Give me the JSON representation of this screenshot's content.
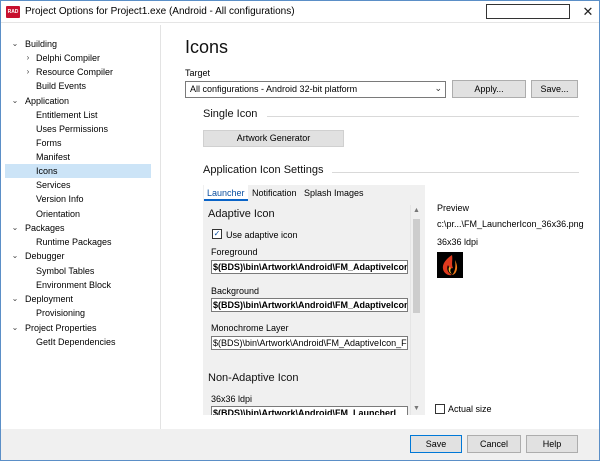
{
  "window": {
    "title": "Project Options for Project1.exe  (Android - All configurations)",
    "app_icon_text": "RAD",
    "close_glyph": "✕"
  },
  "tree": {
    "items": [
      {
        "label": "Building",
        "toggle": "⌄"
      },
      {
        "label": "Delphi Compiler",
        "toggle": "›"
      },
      {
        "label": "Resource Compiler",
        "toggle": "›"
      },
      {
        "label": "Build Events",
        "toggle": ""
      },
      {
        "label": "Application",
        "toggle": "⌄"
      },
      {
        "label": "Entitlement List",
        "toggle": ""
      },
      {
        "label": "Uses Permissions",
        "toggle": ""
      },
      {
        "label": "Forms",
        "toggle": ""
      },
      {
        "label": "Manifest",
        "toggle": ""
      },
      {
        "label": "Icons",
        "toggle": ""
      },
      {
        "label": "Services",
        "toggle": ""
      },
      {
        "label": "Version Info",
        "toggle": ""
      },
      {
        "label": "Orientation",
        "toggle": ""
      },
      {
        "label": "Packages",
        "toggle": "⌄"
      },
      {
        "label": "Runtime Packages",
        "toggle": ""
      },
      {
        "label": "Debugger",
        "toggle": "⌄"
      },
      {
        "label": "Symbol Tables",
        "toggle": ""
      },
      {
        "label": "Environment Block",
        "toggle": ""
      },
      {
        "label": "Deployment",
        "toggle": "⌄"
      },
      {
        "label": "Provisioning",
        "toggle": ""
      },
      {
        "label": "Project Properties",
        "toggle": "⌄"
      },
      {
        "label": "GetIt Dependencies",
        "toggle": ""
      }
    ]
  },
  "main": {
    "title": "Icons",
    "target_label": "Target",
    "target_value": "All configurations - Android 32-bit platform",
    "apply_label": "Apply...",
    "save_label": "Save...",
    "single_icon_title": "Single Icon",
    "artwork_label": "Artwork Generator",
    "app_icon_settings_title": "Application Icon Settings",
    "tabs": [
      {
        "label": "Launcher"
      },
      {
        "label": "Notification"
      },
      {
        "label": "Splash Images"
      }
    ],
    "panel": {
      "adaptive_title": "Adaptive Icon",
      "use_adaptive_label": "Use adaptive icon",
      "use_adaptive_check": "✓",
      "foreground_label": "Foreground",
      "foreground_value": "$(BDS)\\bin\\Artwork\\Android\\FM_AdaptiveIcon_F",
      "background_label": "Background",
      "background_value": "$(BDS)\\bin\\Artwork\\Android\\FM_AdaptiveIcon_B",
      "monochrome_label": "Monochrome Layer",
      "monochrome_value": "$(BDS)\\bin\\Artwork\\Android\\FM_AdaptiveIcon_For",
      "non_adaptive_title": "Non-Adaptive Icon",
      "ldpi_label": "36x36 ldpi",
      "ldpi_value": "$(BDS)\\bin\\Artwork\\Android\\FM_LauncherI"
    },
    "preview": {
      "label": "Preview",
      "file": "c:\\pr...\\FM_LauncherIcon_36x36.png",
      "size": "36x36 ldpi",
      "actual_size_label": "Actual size"
    }
  },
  "footer": {
    "save_label": "Save",
    "cancel_label": "Cancel",
    "help_label": "Help"
  }
}
